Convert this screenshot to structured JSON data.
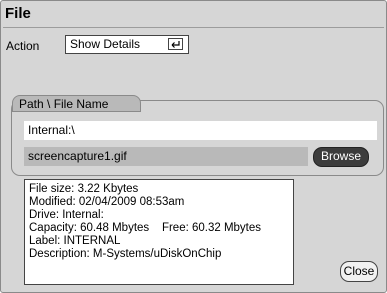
{
  "window": {
    "title": "File"
  },
  "action": {
    "label": "Action",
    "selected": "Show Details"
  },
  "path_group": {
    "label": "Path \\ File Name",
    "path": "Internal:\\",
    "filename": "screencapture1.gif",
    "browse_label": "Browse"
  },
  "details": {
    "lines": [
      "File size: 3.22 Kbytes",
      "Modified: 02/04/2009  08:53am",
      "Drive: Internal:",
      "Capacity: 60.48 Mbytes    Free: 60.32 Mbytes",
      "Label: INTERNAL",
      "Description: M-Systems/uDiskOnChip"
    ]
  },
  "close_label": "Close",
  "colors": {
    "window_bg": "#d6d6d6",
    "field_bg": "#ffffff",
    "disabled_field_bg": "#b9b9b9",
    "browse_bg": "#3c3c3c"
  }
}
